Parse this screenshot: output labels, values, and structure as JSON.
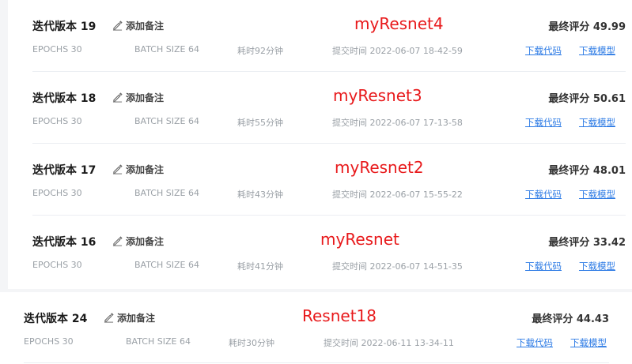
{
  "versions": [
    {
      "title": "迭代版本 19",
      "note_label": "添加备注",
      "annotation": "myResnet4",
      "score": "最终评分 49.99",
      "epochs": "EPOCHS 30",
      "batch": "BATCH SIZE 64",
      "duration": "耗时92分钟",
      "submit_time": "提交时间 2022-06-07 18-42-59",
      "download_code": "下载代码",
      "download_model": "下载模型"
    },
    {
      "title": "迭代版本 18",
      "note_label": "添加备注",
      "annotation": "myResnet3",
      "score": "最终评分 50.61",
      "epochs": "EPOCHS 30",
      "batch": "BATCH SIZE 64",
      "duration": "耗时55分钟",
      "submit_time": "提交时间 2022-06-07 17-13-58",
      "download_code": "下载代码",
      "download_model": "下载模型"
    },
    {
      "title": "迭代版本 17",
      "note_label": "添加备注",
      "annotation": "myResnet2",
      "score": "最终评分 48.01",
      "epochs": "EPOCHS 30",
      "batch": "BATCH SIZE 64",
      "duration": "耗时43分钟",
      "submit_time": "提交时间 2022-06-07 15-55-22",
      "download_code": "下载代码",
      "download_model": "下载模型"
    },
    {
      "title": "迭代版本 16",
      "note_label": "添加备注",
      "annotation": "myResnet",
      "score": "最终评分 33.42",
      "epochs": "EPOCHS 30",
      "batch": "BATCH SIZE 64",
      "duration": "耗时41分钟",
      "submit_time": "提交时间 2022-06-07 14-51-35",
      "download_code": "下载代码",
      "download_model": "下载模型"
    },
    {
      "title": "迭代版本 24",
      "note_label": "添加备注",
      "annotation": "Resnet18",
      "score": "最终评分 44.43",
      "epochs": "EPOCHS 30",
      "batch": "BATCH SIZE 64",
      "duration": "耗时30分钟",
      "submit_time": "提交时间 2022-06-11 13-34-11",
      "download_code": "下载代码",
      "download_model": "下载模型"
    }
  ],
  "icons": {
    "note": "edit-icon"
  },
  "colors": {
    "annotation": "#e8191b",
    "link": "#2d7be5",
    "meta": "#9aa0a6",
    "title": "#1a1a1a"
  }
}
